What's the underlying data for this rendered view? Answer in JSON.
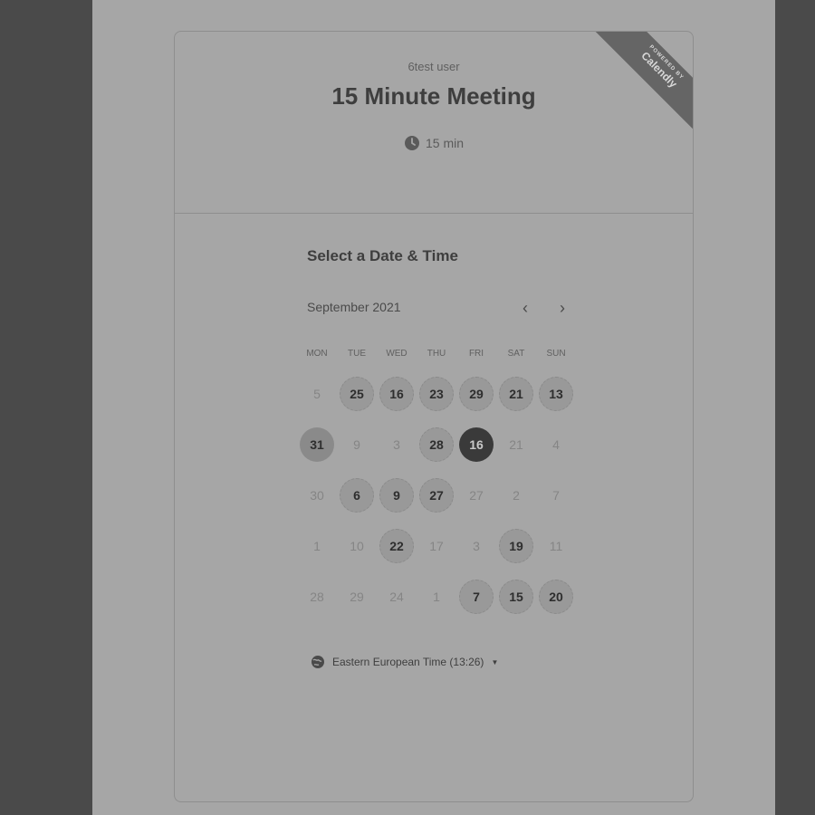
{
  "header": {
    "host": "6test user",
    "title": "15 Minute Meeting",
    "duration": "15 min",
    "ribbon_sub": "POWERED BY",
    "ribbon_brand": "Calendly"
  },
  "picker": {
    "title": "Select a Date & Time",
    "month": "September 2021",
    "prev_icon": "chevron-left-icon",
    "next_icon": "chevron-right-icon",
    "weekdays": [
      "MON",
      "TUE",
      "WED",
      "THU",
      "FRI",
      "SAT",
      "SUN"
    ],
    "days": [
      {
        "label": "5",
        "state": "disabled"
      },
      {
        "label": "25",
        "state": "available"
      },
      {
        "label": "16",
        "state": "available"
      },
      {
        "label": "23",
        "state": "available"
      },
      {
        "label": "29",
        "state": "available"
      },
      {
        "label": "21",
        "state": "available"
      },
      {
        "label": "13",
        "state": "available"
      },
      {
        "label": "31",
        "state": "today"
      },
      {
        "label": "9",
        "state": "disabled"
      },
      {
        "label": "3",
        "state": "disabled"
      },
      {
        "label": "28",
        "state": "available"
      },
      {
        "label": "16",
        "state": "selected"
      },
      {
        "label": "21",
        "state": "disabled"
      },
      {
        "label": "4",
        "state": "disabled"
      },
      {
        "label": "30",
        "state": "disabled"
      },
      {
        "label": "6",
        "state": "available"
      },
      {
        "label": "9",
        "state": "available"
      },
      {
        "label": "27",
        "state": "available"
      },
      {
        "label": "27",
        "state": "disabled"
      },
      {
        "label": "2",
        "state": "disabled"
      },
      {
        "label": "7",
        "state": "disabled"
      },
      {
        "label": "1",
        "state": "disabled"
      },
      {
        "label": "10",
        "state": "disabled"
      },
      {
        "label": "22",
        "state": "available"
      },
      {
        "label": "17",
        "state": "disabled"
      },
      {
        "label": "3",
        "state": "disabled"
      },
      {
        "label": "19",
        "state": "available"
      },
      {
        "label": "11",
        "state": "disabled"
      },
      {
        "label": "28",
        "state": "disabled"
      },
      {
        "label": "29",
        "state": "disabled"
      },
      {
        "label": "24",
        "state": "disabled"
      },
      {
        "label": "1",
        "state": "disabled"
      },
      {
        "label": "7",
        "state": "available"
      },
      {
        "label": "15",
        "state": "available"
      },
      {
        "label": "20",
        "state": "available"
      }
    ]
  },
  "timezone": {
    "label": "Eastern European Time (13:26)",
    "icon": "globe-icon"
  }
}
